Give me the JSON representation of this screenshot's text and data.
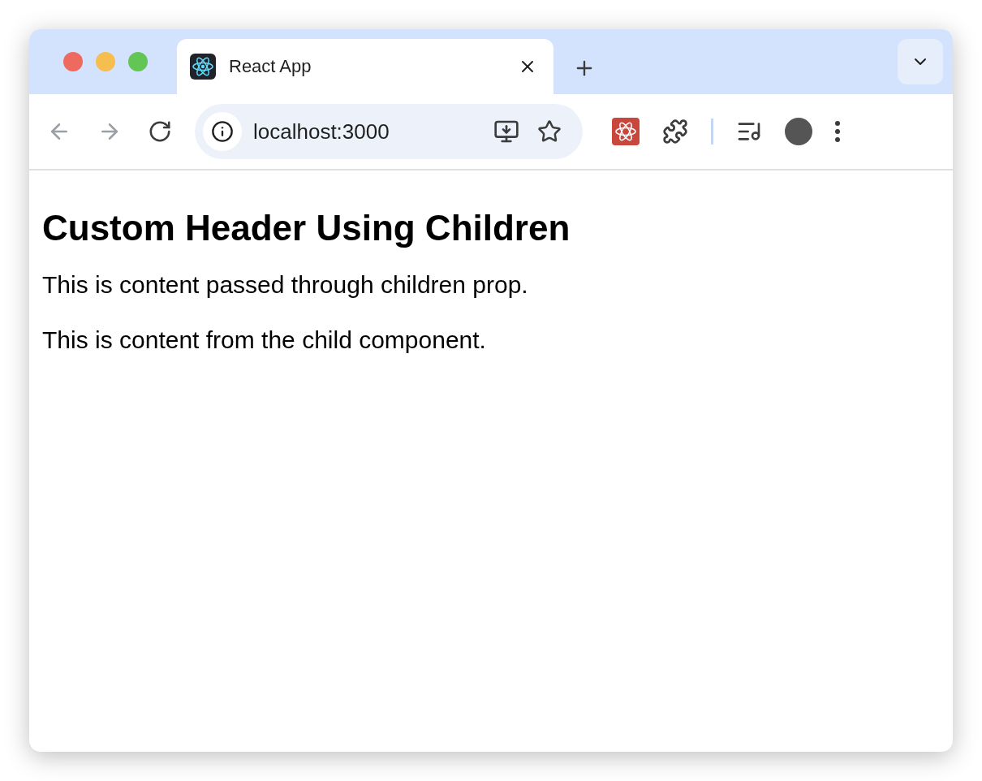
{
  "tabs": [
    {
      "title": "React App",
      "selected": true
    }
  ],
  "toolbar": {
    "nav": [
      {
        "kind": "back",
        "disabled": true
      },
      {
        "kind": "forward",
        "disabled": true
      },
      {
        "kind": "reload",
        "disabled": false
      }
    ],
    "address": "localhost:3000"
  },
  "page": {
    "heading": "Custom Header Using Children",
    "paragraphs": [
      "This is content passed through children prop.",
      "This is content from the child component."
    ]
  }
}
